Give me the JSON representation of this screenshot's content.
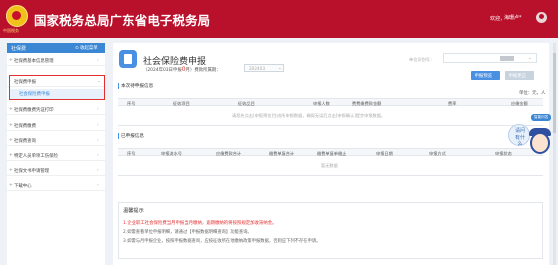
{
  "header": {
    "title": "国家税务总局广东省电子税务局",
    "emblem_text": "中国税务",
    "welcome": "欢迎，",
    "user_name": "海珊卢*"
  },
  "sidebar": {
    "head": "社保费",
    "collapse": "⊙ 收起菜单",
    "items": [
      {
        "label": "社保费基本信息管理",
        "prefix": "+"
      },
      {
        "label": "社保费申报",
        "prefix": "-"
      },
      {
        "label": "社保费缴费凭证打印",
        "prefix": "+"
      },
      {
        "label": "社保费缴费",
        "prefix": "+"
      },
      {
        "label": "社保费查询",
        "prefix": "+"
      },
      {
        "label": "特定人员单项工伤保险",
        "prefix": "+"
      },
      {
        "label": "社保文书申请管理",
        "prefix": "+"
      },
      {
        "label": "下载中心",
        "prefix": "+"
      }
    ],
    "selected_sub": "社会保险费申报"
  },
  "main": {
    "title": "社会保险费申报",
    "period_prefix": "（2024年03日申报",
    "period_count": "0",
    "period_suffix": "月）费款所属期：",
    "period_value": "202403",
    "tax_label": "单位识别号：",
    "btn_declare": "申报预览",
    "btn_check": "申报更正",
    "section1": "本次待申报信息",
    "unit": "单位：元，人",
    "table1_headers": [
      "序号",
      "征收项目",
      "征收品目",
      "申报人数",
      "费费缴费款金额",
      "费率",
      "应缴金额"
    ],
    "table1_empty": "请您先点击[申报预览]生成所申报数据，确保无误后点击[申报确认]提交申报数据。",
    "section2": "已申报信息",
    "table2_headers": [
      "序号",
      "申报流水号",
      "应缴费款合计",
      "缴费单复合计",
      "缴费单复单缴止",
      "申报日期",
      "申报方式",
      "申报状态"
    ],
    "table2_empty": "暂无数据",
    "tips_title": "温馨提示",
    "tips": [
      "1.企业职工社会保险费当月申报当月缴纳，逾期缴纳的将按照规定加收滞纳金。",
      "2.如需查看单位申报明细，请通过【申报数据明细查询】功能查询。",
      "3.如需与月申报企业，按照申报数据查询，应按征收所在地缴纳政策申报数据，否则应下列不存在申请。"
    ]
  },
  "assistant": {
    "bubble": "请问有什么",
    "float_btn": "智能问答"
  },
  "colors": {
    "header_bg": "#b9102b",
    "accent": "#4a90e2",
    "highlight": "#e23030"
  }
}
